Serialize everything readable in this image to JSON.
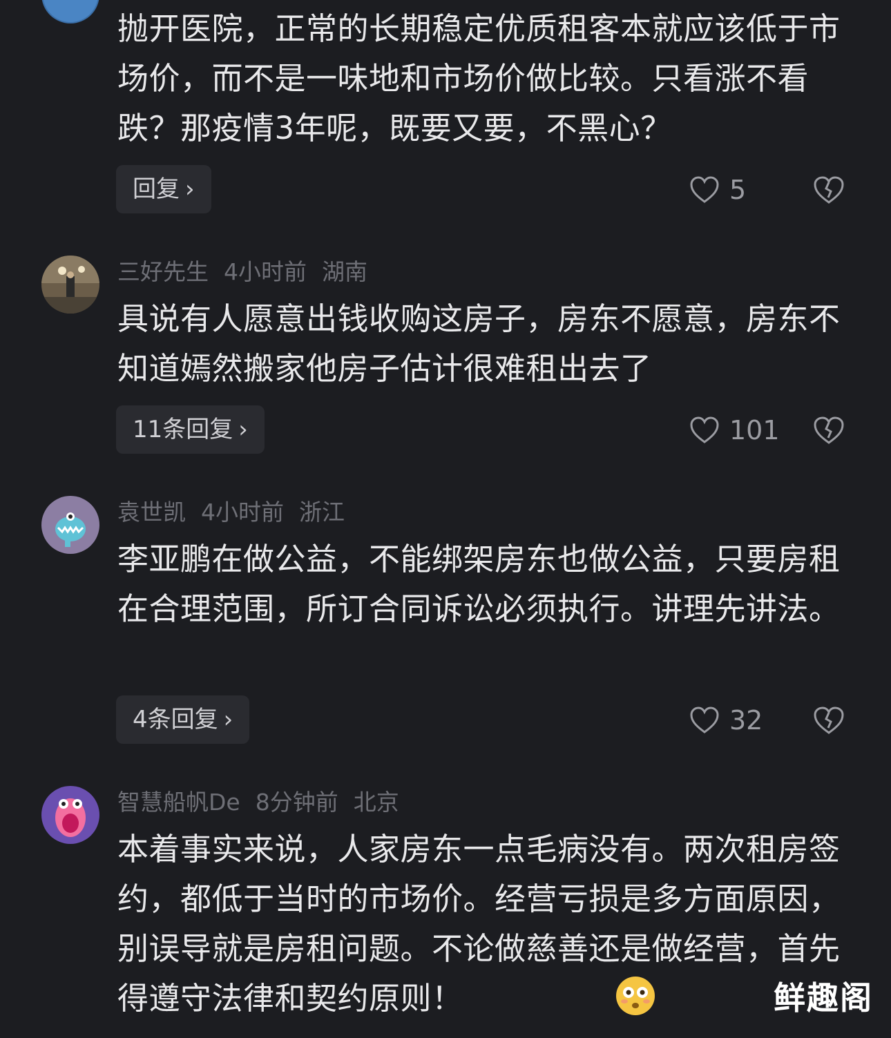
{
  "comments": [
    {
      "text": "抛开医院，正常的长期稳定优质租客本就应该低于市场价，而不是一味地和市场价做比较。只看涨不看跌？那疫情3年呢，既要又要，不黑心？",
      "reply_label": "回复",
      "likes": "5"
    },
    {
      "user": "三好先生",
      "time": "4小时前",
      "location": "湖南",
      "text": "具说有人愿意出钱收购这房子，房东不愿意，房东不知道嫣然搬家他房子估计很难租出去了",
      "reply_label": "11条回复",
      "likes": "101"
    },
    {
      "user": "袁世凯",
      "time": "4小时前",
      "location": "浙江",
      "text": "李亚鹏在做公益，不能绑架房东也做公益，只要房租在合理范围，所订合同诉讼必须执行。讲理先讲法。",
      "reply_label": "4条回复",
      "likes": "32"
    },
    {
      "user": "智慧船帆De",
      "time": "8分钟前",
      "location": "北京",
      "text": "本着事实来说，人家房东一点毛病没有。两次租房签约，都低于当时的市场价。经营亏损是多方面原因，别误导就是房租问题。不论做慈善还是做经营，首先得遵守法律和契约原则！",
      "emoji": "flushed-face-emoji"
    }
  ],
  "icons": {
    "reply_chevron": "chevron-right-icon",
    "like": "heart-icon",
    "dislike": "broken-heart-icon"
  },
  "watermark": "鲜趣阁"
}
